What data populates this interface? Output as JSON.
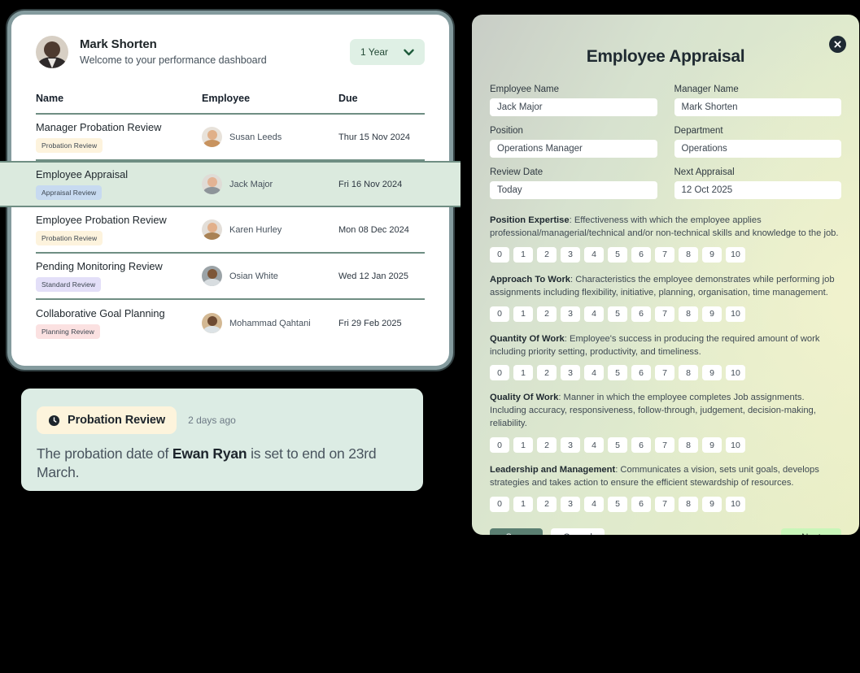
{
  "dashboard": {
    "profile": {
      "name": "Mark Shorten",
      "subtitle": "Welcome to your performance dashboard",
      "avatar_icon": "user-avatar"
    },
    "period_filter": {
      "value": "1 Year",
      "chevron_icon": "chevron-down-icon"
    },
    "table": {
      "columns": [
        "Name",
        "Employee",
        "Due"
      ],
      "rows": [
        {
          "name": "Manager Probation Review",
          "badge": "Probation Review",
          "badge_type": "probation",
          "employee": "Susan Leeds",
          "due": "Thur 15 Nov 2024",
          "highlighted": false
        },
        {
          "name": "Employee Appraisal",
          "badge": "Appraisal Review",
          "badge_type": "appraisal",
          "employee": "Jack Major",
          "due": "Fri 16 Nov 2024",
          "highlighted": true
        },
        {
          "name": "Employee Probation Review",
          "badge": "Probation Review",
          "badge_type": "probation",
          "employee": "Karen Hurley",
          "due": "Mon 08 Dec 2024",
          "highlighted": false
        },
        {
          "name": "Pending Monitoring Review",
          "badge": "Standard Review",
          "badge_type": "standard",
          "employee": "Osian White",
          "due": "Wed 12 Jan 2025",
          "highlighted": false
        },
        {
          "name": "Collaborative Goal Planning",
          "badge": "Planning Review",
          "badge_type": "planning",
          "employee": "Mohammad Qahtani",
          "due": "Fri 29 Feb 2025",
          "highlighted": false
        }
      ]
    }
  },
  "notification": {
    "pill_label": "Probation Review",
    "pill_icon": "clock-icon",
    "timestamp": "2 days ago",
    "message_pre": "The probation date of ",
    "message_name": "Ewan Ryan",
    "message_post": " is set to end on 23rd March."
  },
  "modal": {
    "title": "Employee Appraisal",
    "close_icon": "close-icon",
    "fields": [
      {
        "label": "Employee Name",
        "value": "Jack Major"
      },
      {
        "label": "Manager Name",
        "value": "Mark Shorten"
      },
      {
        "label": "Position",
        "value": "Operations Manager"
      },
      {
        "label": "Department",
        "value": "Operations"
      },
      {
        "label": "Review Date",
        "value": "Today"
      },
      {
        "label": "Next Appraisal",
        "value": "12 Oct 2025"
      }
    ],
    "scale_options": [
      "0",
      "1",
      "2",
      "3",
      "4",
      "5",
      "6",
      "7",
      "8",
      "9",
      "10"
    ],
    "criteria": [
      {
        "title": "Position Expertise",
        "description": ": Effectiveness with which the employee applies professional/managerial/technical and/or non-technical skills and knowledge to the job."
      },
      {
        "title": "Approach To Work",
        "description": ": Characteristics the employee demonstrates while performing job assignments including flexibility, initiative, planning, organisation, time management."
      },
      {
        "title": "Quantity Of Work",
        "description": ": Employee's success in producing the required amount of work including priority setting, productivity, and timeliness."
      },
      {
        "title": "Quality Of Work",
        "description": ": Manner in which the employee completes Job assignments. Including accuracy, responsiveness, follow-through, judgement, decision-making, reliability."
      },
      {
        "title": "Leadership and Management",
        "description": ": Communicates a vision, sets unit goals, develops strategies and takes action to ensure the efficient stewardship of resources."
      }
    ],
    "actions": {
      "save": "Save",
      "cancel": "Cancel",
      "next": "Next"
    }
  },
  "colors": {
    "page_background": "#000000",
    "card_background": "#ffffff",
    "highlight_row": "#dbeade",
    "notification_background": "#dcece4",
    "save_button": "#5b7f72",
    "next_button": "#c9f6b9",
    "filter_background": "#dff0e5",
    "table_divider": "#6f8e83",
    "badge_probation": "#fdf3dd",
    "badge_appraisal": "#c7daf0",
    "badge_standard": "#e3dff8",
    "badge_planning": "#fbe1e1"
  }
}
